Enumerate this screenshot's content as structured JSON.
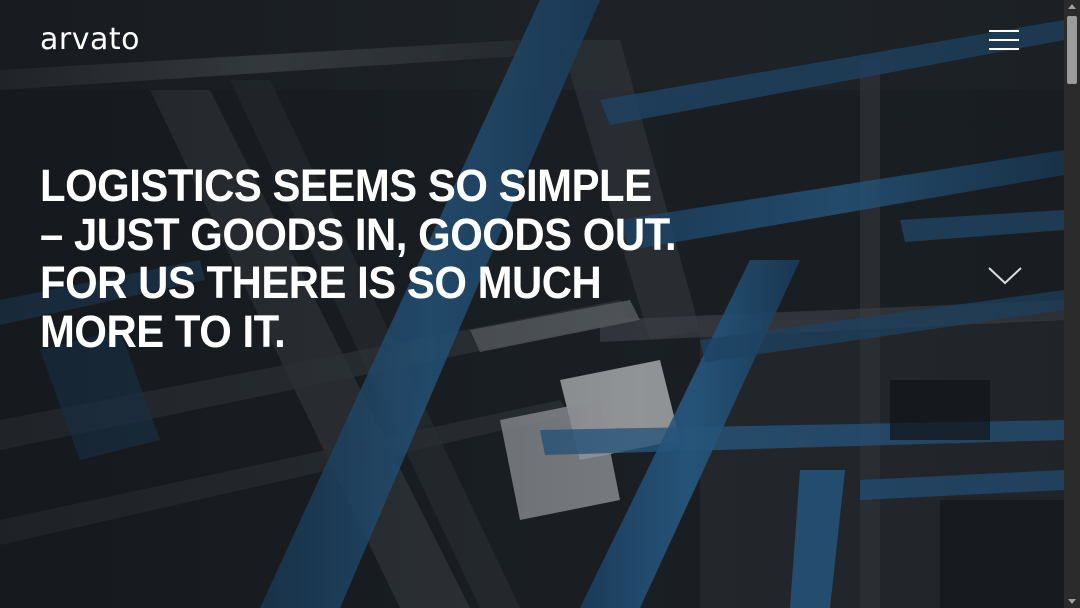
{
  "header": {
    "logo_text": "arvato",
    "menu_icon": "hamburger-icon"
  },
  "hero": {
    "headline_lines": [
      "LOGISTICS SEEMS SO SIMPLE",
      "– JUST GOODS IN, GOODS OUT.",
      "FOR US THERE IS SO MUCH",
      "MORE TO IT."
    ],
    "scroll_icon": "chevron-down-icon",
    "background": "warehouse conveyor image"
  },
  "colors": {
    "text": "#ffffff",
    "beam_blue": "#2c6a9e",
    "background_dark": "#1b1f24"
  }
}
